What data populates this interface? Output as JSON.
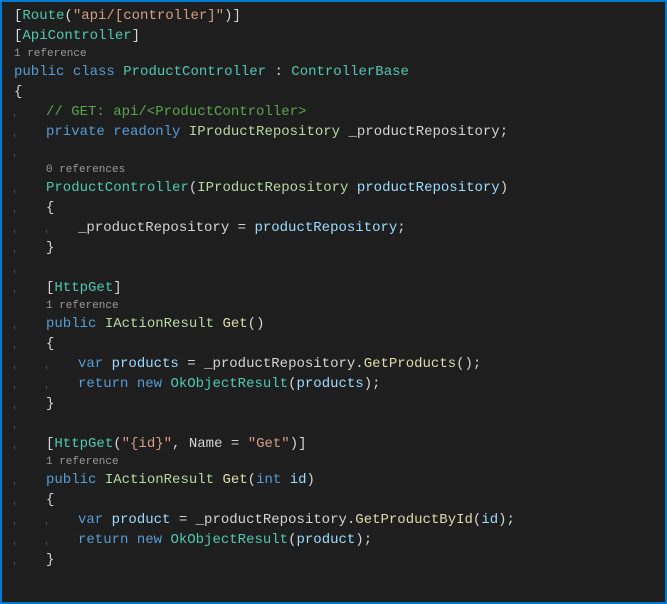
{
  "code": {
    "route_attr_open": "[",
    "route_name": "Route",
    "route_paren_open": "(",
    "route_str": "\"api/[controller]\"",
    "route_close": ")]",
    "api_attr": "[",
    "api_name": "ApiController",
    "api_close": "]",
    "codelens_class": "1 reference",
    "kw_public": "public",
    "kw_class": "class",
    "class_name": "ProductController",
    "colon": ":",
    "base_class": "ControllerBase",
    "brace_open": "{",
    "comment_get": "// GET: api/<ProductController>",
    "kw_private": "private",
    "kw_readonly": "readonly",
    "repo_iface": "IProductRepository",
    "repo_field": "_productRepository",
    "semi": ";",
    "codelens_ctor": "0 references",
    "ctor_name": "ProductController",
    "paren_open": "(",
    "ctor_param_type": "IProductRepository",
    "ctor_param_name": "productRepository",
    "paren_close": ")",
    "assign_field": "_productRepository",
    "equals": " = ",
    "assign_val": "productRepository",
    "brace_close": "}",
    "httpget_attr": "[",
    "httpget_name": "HttpGet",
    "httpget_close": "]",
    "codelens_get1": "1 reference",
    "ret_type": "IActionResult",
    "method_get": "Get",
    "empty_parens": "()",
    "kw_var": "var",
    "products_var": "products",
    "dot": ".",
    "getproducts": "GetProducts",
    "call_close": "();",
    "kw_return": "return",
    "kw_new": "new",
    "okresult": "OkObjectResult",
    "okarg1": "products",
    "okend": ");",
    "httpget2_open": "[",
    "httpget2_name": "HttpGet",
    "httpget2_args_open": "(",
    "httpget2_str": "\"{id}\"",
    "httpget2_comma": ", ",
    "httpget2_nameprop": "Name",
    "httpget2_eq": " = ",
    "httpget2_namestr": "\"Get\"",
    "httpget2_close": ")]",
    "codelens_get2": "1 reference",
    "kw_int": "int",
    "param_id": "id",
    "product_var": "product",
    "getbyid": "GetProductById",
    "okarg2": "product"
  }
}
